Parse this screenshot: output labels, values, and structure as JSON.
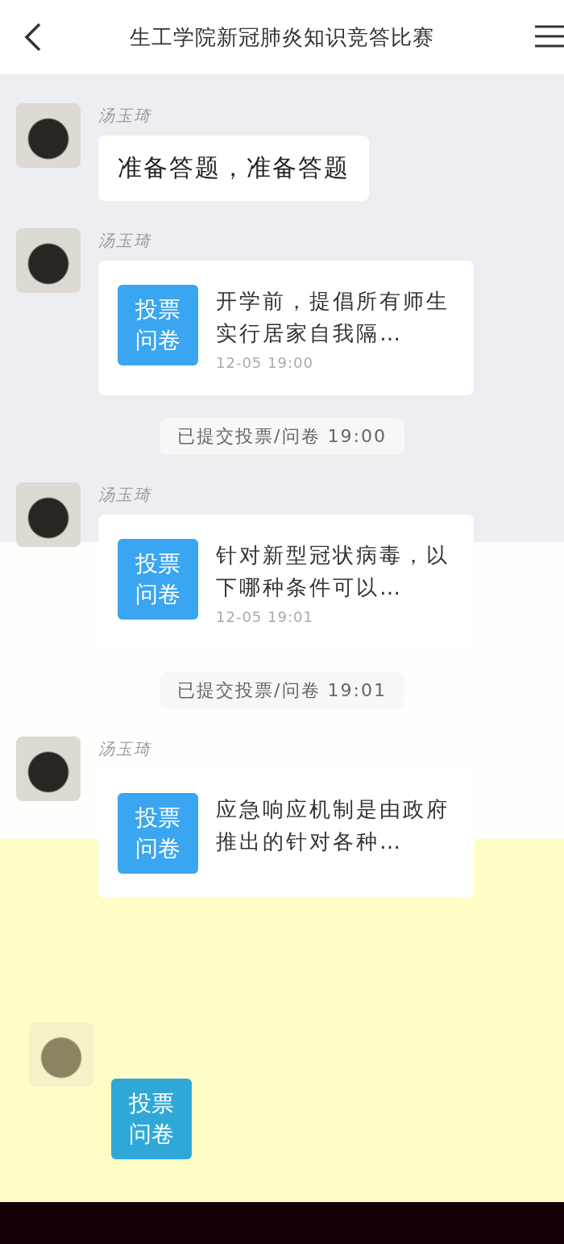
{
  "header": {
    "title": "生工学院新冠肺炎知识竞答比赛"
  },
  "messages": [
    {
      "kind": "text",
      "sender": "汤玉琦",
      "text": "准备答题，准备答题"
    },
    {
      "kind": "vote",
      "sender": "汤玉琦",
      "badge": [
        "投票",
        "问卷"
      ],
      "title": "开学前，提倡所有师生实行居家自我隔…",
      "time": "12-05  19:00"
    },
    {
      "kind": "notice",
      "text": "已提交投票/问卷  19:00"
    },
    {
      "kind": "vote",
      "sender": "汤玉琦",
      "badge": [
        "投票",
        "问卷"
      ],
      "title": "针对新型冠状病毒，以下哪种条件可以…",
      "time": "12-05  19:01"
    },
    {
      "kind": "notice",
      "text": "已提交投票/问卷  19:01"
    },
    {
      "kind": "vote",
      "sender": "汤玉琦",
      "badge": [
        "投票",
        "问卷"
      ],
      "title": "应急响应机制是由政府推出的针对各种…"
    },
    {
      "kind": "vote",
      "badge": [
        "投票",
        "问卷"
      ]
    }
  ]
}
